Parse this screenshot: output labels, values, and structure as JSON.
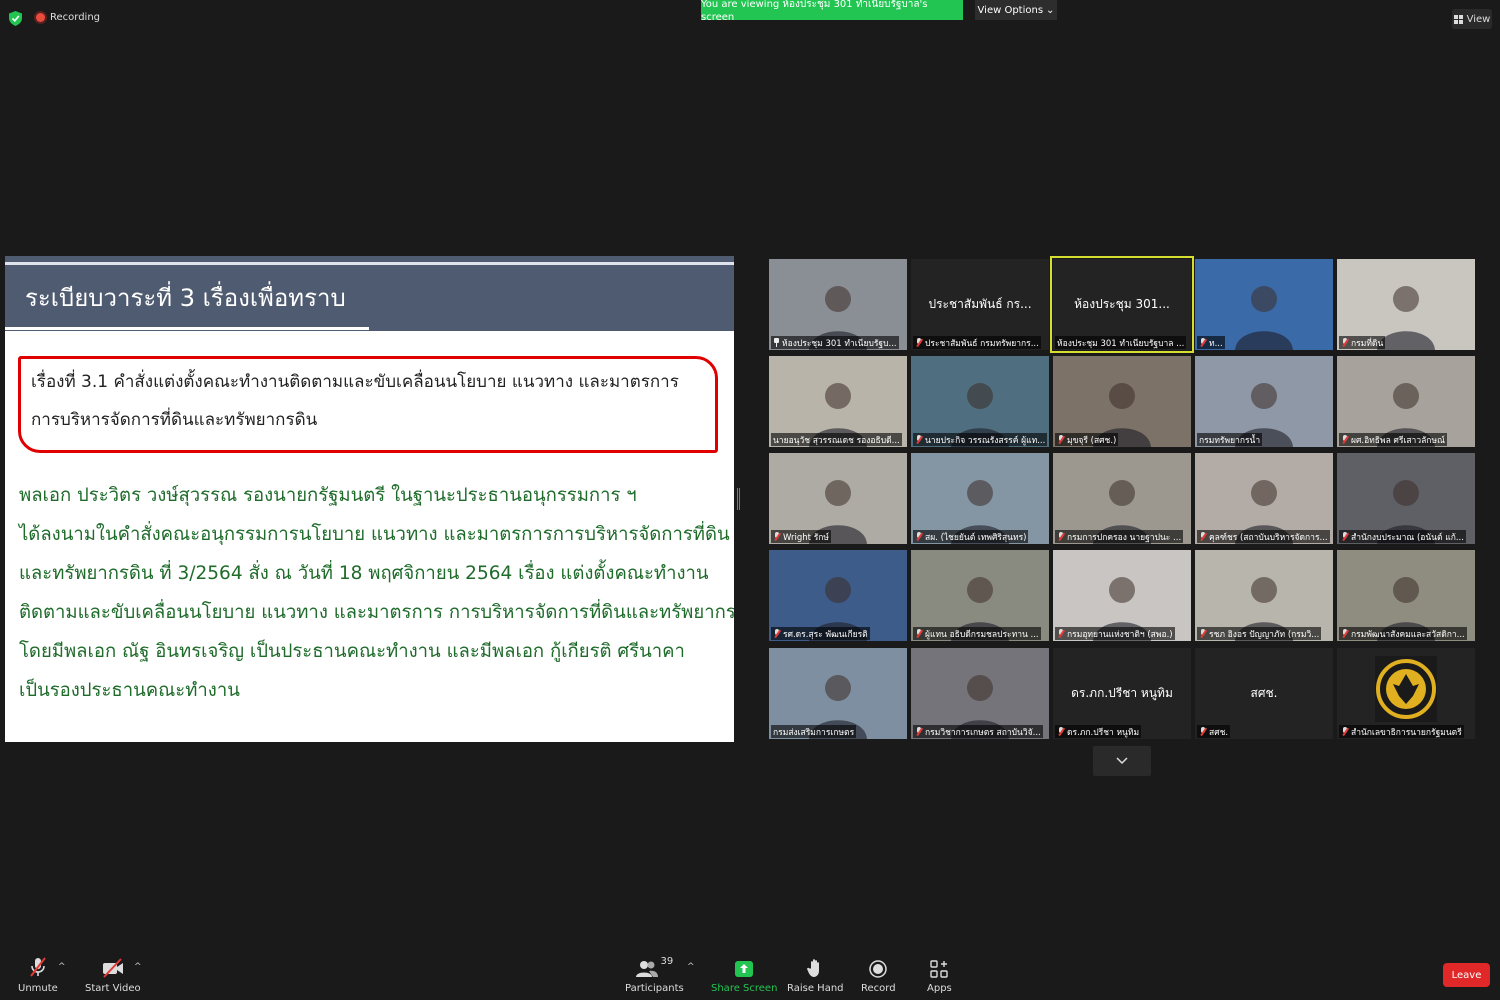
{
  "topbar": {
    "recording": "Recording",
    "viewing_banner": "You are viewing ห้องประชุม 301 ทำเนียบรัฐบาล's screen",
    "view_options": "View Options",
    "view": "View"
  },
  "slide": {
    "title": "ระเบียบวาระที่ 3  เรื่องเพื่อทราบ",
    "subject_lines": [
      "เรื่องที่ 3.1  คำสั่งแต่งตั้งคณะทำงานติดตามและขับเคลื่อนนโยบาย แนวทาง และมาตรการ",
      "การบริหารจัดการที่ดินและทรัพยากรดิน"
    ],
    "body_lines": [
      "        พลเอก ประวิตร วงษ์สุวรรณ รองนายกรัฐมนตรี ในฐานะประธานอนุกรรมการ ฯ",
      "ได้ลงนามในคำสั่งคณะอนุกรรมการนโยบาย แนวทาง และมาตรการการบริหารจัดการที่ดิน",
      "และทรัพยากรดิน ที่ 3/2564 สั่ง ณ วันที่ 18 พฤศจิกายน 2564 เรื่อง แต่งตั้งคณะทำงาน",
      "ติดตามและขับเคลื่อนนโยบาย แนวทาง และมาตรการ การบริหารจัดการที่ดินและทรัพยากรดิน",
      "โดยมีพลเอก ณัฐ อินทรเจริญ เป็นประธานคณะทำงาน และมีพลเอก กู้เกียรติ ศรีนาคา",
      "เป็นรองประธานคณะทำงาน"
    ]
  },
  "participants": [
    {
      "name": "ห้องประชุม 301 ทำเนียบรัฐบ...",
      "big": "",
      "icon": "pin",
      "bg": "#8a8f96"
    },
    {
      "name": "ประชาสัมพันธ์ กรมทรัพยากร...",
      "big": "ประชาสัมพันธ์ กร...",
      "icon": "mute",
      "bg": "#232323"
    },
    {
      "name": "ห้องประชุม 301 ทำเนียบรัฐบาล ...",
      "big": "ห้องประชุม 301...",
      "icon": "none",
      "bg": "#232323",
      "selected": true
    },
    {
      "name": "ท...",
      "big": "",
      "icon": "mute",
      "bg": "#3a6aa8"
    },
    {
      "name": "กรมที่ดิน",
      "big": "",
      "icon": "mute",
      "bg": "#c9c6c0"
    },
    {
      "name": "นายอนุวัช สุวรรณเดช รองอธิบดี...",
      "big": "",
      "icon": "none",
      "bg": "#b9b4aa"
    },
    {
      "name": "นายประกิจ วรรณรังสรรค์ ผู้แท...",
      "big": "",
      "icon": "mute",
      "bg": "#4f6f80"
    },
    {
      "name": "มุขจุรี (สศช.)",
      "big": "",
      "icon": "mute",
      "bg": "#7c7268"
    },
    {
      "name": "กรมทรัพยากรน้ำ",
      "big": "",
      "icon": "none",
      "bg": "#8e98a6"
    },
    {
      "name": "ผศ.อิทธิพล ศรีเสาวลักษณ์",
      "big": "",
      "icon": "mute",
      "bg": "#a7a29c"
    },
    {
      "name": "Wright รักษ์",
      "big": "",
      "icon": "mute",
      "bg": "#aeaaa4"
    },
    {
      "name": "สผ. (ไชยยันต์ เทพศิริสุนทร)",
      "big": "",
      "icon": "mute",
      "bg": "#8496a4"
    },
    {
      "name": "กรมการปกครอง นายฐาปนะ ...",
      "big": "",
      "icon": "mute",
      "bg": "#9c9890"
    },
    {
      "name": "คุลฑ์ชร (สถาบันบริหารจัดการ...",
      "big": "",
      "icon": "mute",
      "bg": "#b3aca6"
    },
    {
      "name": "สำนักงบประมาณ (อนันต์ แก้...",
      "big": "",
      "icon": "mute",
      "bg": "#5f6066"
    },
    {
      "name": "รศ.ดร.สุระ พัฒนเกียรติ",
      "big": "",
      "icon": "mute",
      "bg": "#3d5c8a"
    },
    {
      "name": "ผู้แทน อธิบดีกรมชลประทาน ...",
      "big": "",
      "icon": "mute",
      "bg": "#8a8b80"
    },
    {
      "name": "กรมอุทยานแห่งชาติฯ (สพอ.)",
      "big": "",
      "icon": "mute",
      "bg": "#c8c5c2"
    },
    {
      "name": "รชภ อิงอร ปัญญาภัท (กรมวิ...",
      "big": "",
      "icon": "mute",
      "bg": "#b7b5ac"
    },
    {
      "name": "กรมพัฒนาสังคมและสวัสดิกา...",
      "big": "",
      "icon": "mute",
      "bg": "#8f8d80"
    },
    {
      "name": "กรมส่งเสริมการเกษตร",
      "big": "",
      "icon": "none",
      "bg": "#7d8fa0"
    },
    {
      "name": "กรมวิชาการเกษตร สถาบันวิจั...",
      "big": "",
      "icon": "mute",
      "bg": "#75747a"
    },
    {
      "name": "ดร.ภก.ปรีชา หนูทิม",
      "big": "ดร.ภก.ปรีชา หนูทิม",
      "icon": "mute",
      "bg": "#232323"
    },
    {
      "name": "สศช.",
      "big": "สศช.",
      "icon": "mute",
      "bg": "#232323"
    },
    {
      "name": "สำนักเลขาธิการนายกรัฐมนตรี",
      "big": "",
      "icon": "mute",
      "bg": "#232323",
      "logo": true
    }
  ],
  "toolbar": {
    "unmute": "Unmute",
    "start_video": "Start Video",
    "participants": "Participants",
    "participant_count": "39",
    "share_screen": "Share Screen",
    "raise_hand": "Raise Hand",
    "record": "Record",
    "apps": "Apps",
    "leave": "Leave"
  },
  "colors": {
    "background": "#1a1a1a",
    "share_green": "#23c552",
    "leave_red": "#e02828",
    "selected_border": "#d6df2f",
    "slide_header": "#4f5b70",
    "slide_body_text": "#1e6b2a",
    "highlight_box": "#e00000"
  }
}
